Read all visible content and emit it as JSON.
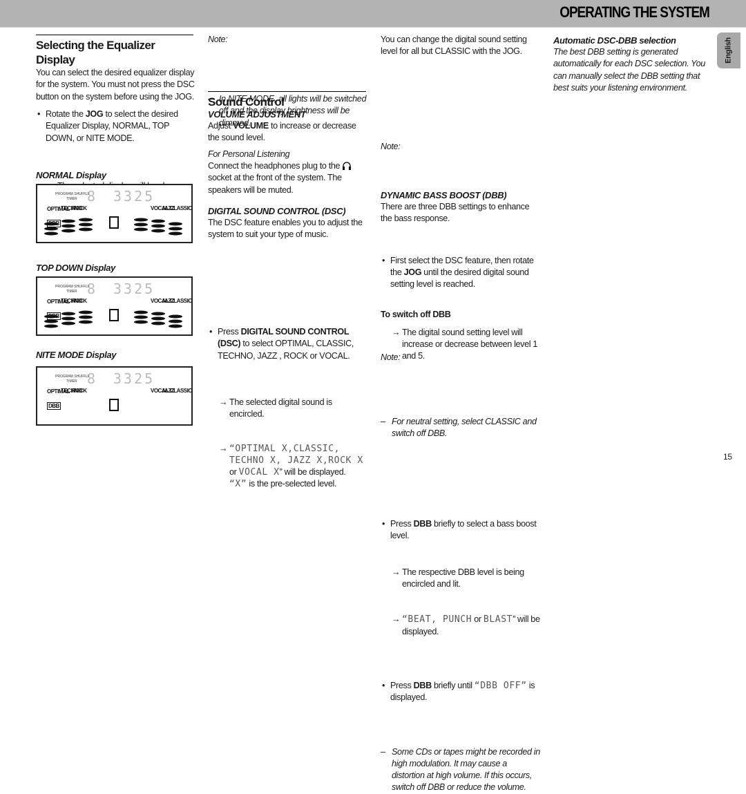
{
  "header": {
    "title": "OPERATING THE SYSTEM"
  },
  "language_tab": "English",
  "page_number": "15",
  "col1": {
    "title": "Selecting the Equalizer Display",
    "intro": "You can select the desired equalizer display for the system. You must not press the DSC button on the system before using the JOG.",
    "bullet": {
      "pre": "Rotate the ",
      "bold": "JOG",
      "post": " to select the desired Equalizer Display, NORMAL, TOP DOWN, or NITE MODE."
    },
    "arrow": "The selected display will be shown.",
    "displays": [
      {
        "label": "NORMAL Display"
      },
      {
        "label": "TOP DOWN Display"
      },
      {
        "label": "NITE MODE Display"
      }
    ],
    "display_text": {
      "program": "PROGRAM SHUFFLE",
      "timer": "TIMER",
      "digit": "8",
      "number": "3325",
      "modes": [
        "OPTIMAL",
        "TECHNO",
        "ROCK",
        "VOCAL",
        "JAZZ",
        "CLASSIC"
      ],
      "dbb": "DBB"
    }
  },
  "col2": {
    "note_label": "Note:",
    "note": "In NITE MODE, all lights will be switched off and the display brightness will be dimmed.",
    "title": "Sound Control",
    "volume_heading": "VOLUME ADJUSTMENT",
    "volume_text": {
      "pre": "Adjust ",
      "bold": "VOLUME",
      "post": " to increase or decrease the sound level."
    },
    "personal_heading": "For Personal Listening",
    "personal_pre": "Connect the headphones plug to the ",
    "personal_post": " socket at the front of the system. The speakers will be muted.",
    "dsc_heading": "DIGITAL SOUND CONTROL  (DSC)",
    "dsc_intro": "The DSC feature enables you to adjust the system to suit your type of music.",
    "dsc_bullet": {
      "pre": "Press ",
      "bold": "DIGITAL SOUND CONTROL (DSC)",
      "post": " to select OPTIMAL, CLASSIC, TECHNO, JAZZ , ROCK or VOCAL."
    },
    "dsc_arrow1": "The selected digital sound is encircled.",
    "dsc_arrow2_lcd1": "“OPTIMAL X,CLASSIC, TECHNO X, JAZZ X,ROCK X",
    "dsc_arrow2_or": " or ",
    "dsc_arrow2_lcd2": "VOCAL X",
    "dsc_arrow2_post": "” will be displayed.",
    "dsc_x_lcd": "“X”",
    "dsc_x_post": " is the pre-selected level."
  },
  "col3": {
    "intro": "You can change the digital sound setting level for all but CLASSIC with the JOG.",
    "bullet": {
      "pre": "First select the DSC feature, then rotate the ",
      "bold": "JOG",
      "post": " until the desired digital sound setting level is reached."
    },
    "arrow": "The digital sound setting level will increase or decrease between level 1 and 5.",
    "note1_label": "Note:",
    "note1": "For neutral setting, select CLASSIC and switch off DBB.",
    "dbb_heading": "DYNAMIC BASS BOOST  (DBB)",
    "dbb_intro": "There are three DBB settings to enhance the bass response.",
    "dbb_bullet": {
      "pre": "Press ",
      "bold": "DBB",
      "post": " briefly to select a bass boost level."
    },
    "dbb_arrow1": "The respective DBB level is being encircled and lit.",
    "dbb_arrow2_lcd1": "“BEAT, PUNCH",
    "dbb_arrow2_or": " or ",
    "dbb_arrow2_lcd2": "BLAST",
    "dbb_arrow2_post": "” will be displayed.",
    "off_heading": "To switch off DBB",
    "off_bullet": {
      "pre": "Press ",
      "bold": "DBB",
      "mid": " briefly until ",
      "lcd": "“DBB OFF”",
      "post": " is displayed."
    },
    "note2_label": "Note:",
    "note2": "Some CDs or tapes might be recorded in high modulation. It may cause a distortion at high volume. If this occurs, switch off DBB or reduce the volume."
  },
  "col4": {
    "heading": "Automatic DSC-DBB selection",
    "text": "The best DBB setting is generated automatically for each DSC selection. You can manually select the DBB setting that best suits your listening environment."
  }
}
